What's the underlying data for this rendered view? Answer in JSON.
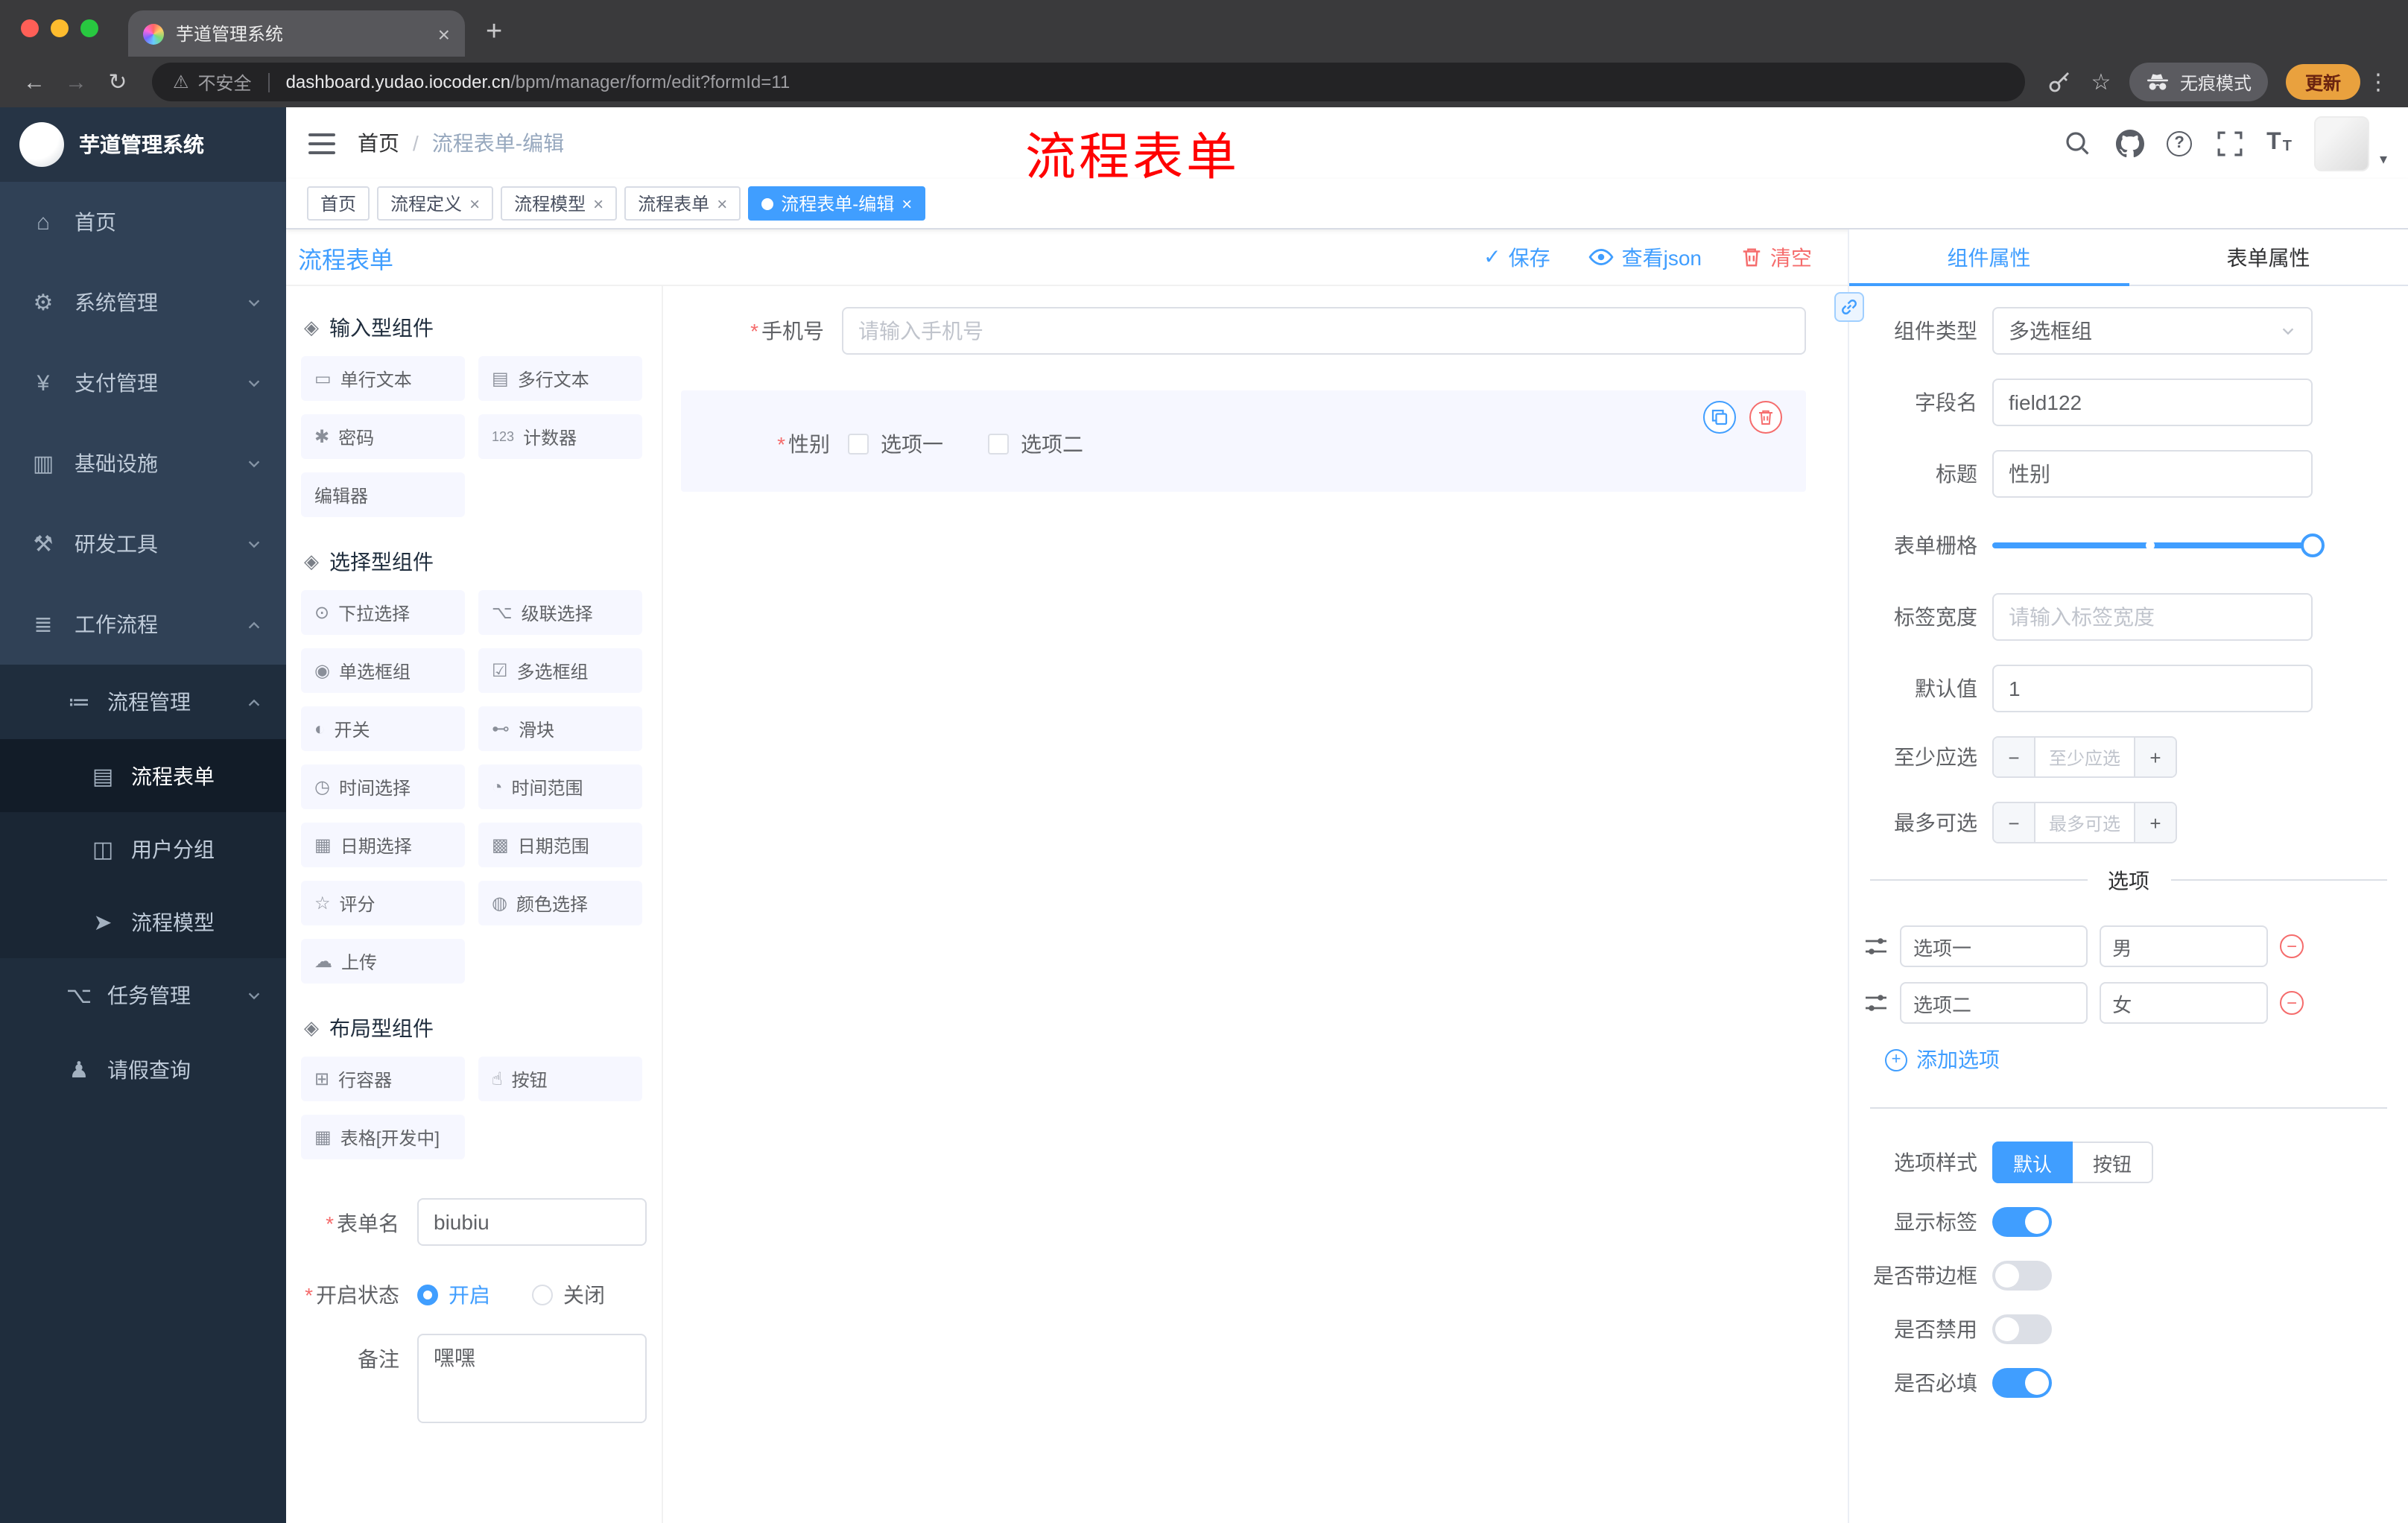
{
  "colors": {
    "accent": "#409eff",
    "danger": "#f56c6c",
    "sidebar_bg": "#304156",
    "sidebar_submenu_bg": "#1f2d3d",
    "active_tag_bg": "#409eff",
    "update_button_bg": "#e9a13e",
    "traffic_red": "#ff5f57",
    "traffic_yellow": "#febc2e",
    "traffic_green": "#28c840"
  },
  "glyphs": {
    "close": "×",
    "plus": "+",
    "minus": "−",
    "back": "←",
    "forward": "→",
    "reload": "↻",
    "warning": "⚠",
    "star": "☆",
    "kebab": "⋮",
    "slash": "/",
    "check": "✓",
    "required": "*",
    "caret_down": "▾",
    "help": "?",
    "font_size_big": "T",
    "font_size_small": "T"
  },
  "browser": {
    "tab_title": "芋道管理系统",
    "security_label": "不安全",
    "url_host": "dashboard.yudao.iocoder.cn",
    "url_path": "/bpm/manager/form/edit?formId=11",
    "incognito_label": "无痕模式",
    "update_label": "更新"
  },
  "sidebar": {
    "logo_title": "芋道管理系统",
    "items": [
      {
        "label": "首页",
        "glyph": "⌂"
      },
      {
        "label": "系统管理",
        "glyph": "⚙"
      },
      {
        "label": "支付管理",
        "glyph": "¥"
      },
      {
        "label": "基础设施",
        "glyph": "▥"
      },
      {
        "label": "研发工具",
        "glyph": "⚒"
      },
      {
        "label": "工作流程",
        "glyph": "≣"
      }
    ],
    "workflow_submenu": {
      "process_mgmt": {
        "label": "流程管理",
        "glyph": "≔"
      },
      "process_children": [
        {
          "label": "流程表单",
          "glyph": "▤"
        },
        {
          "label": "用户分组",
          "glyph": "◫"
        },
        {
          "label": "流程模型",
          "glyph": "➤"
        }
      ],
      "task_mgmt": {
        "label": "任务管理",
        "glyph": "⌥"
      },
      "leave_query": {
        "label": "请假查询",
        "glyph": "♟"
      }
    }
  },
  "header": {
    "breadcrumb": {
      "home": "首页",
      "current": "流程表单-编辑"
    },
    "annotation": "流程表单"
  },
  "tags": [
    {
      "label": "首页"
    },
    {
      "label": "流程定义"
    },
    {
      "label": "流程模型"
    },
    {
      "label": "流程表单"
    },
    {
      "label": "流程表单-编辑"
    }
  ],
  "designer": {
    "title": "流程表单",
    "save": "保存",
    "view_json": "查看json",
    "clear": "清空"
  },
  "palette": {
    "sections": [
      {
        "title": "输入型组件",
        "items": [
          {
            "label": "单行文本",
            "glyph": "▭"
          },
          {
            "label": "多行文本",
            "glyph": "▤"
          },
          {
            "label": "密码",
            "glyph": "✱"
          },
          {
            "label": "计数器",
            "glyph": "123"
          },
          {
            "label": "编辑器",
            "glyph": ""
          }
        ]
      },
      {
        "title": "选择型组件",
        "items": [
          {
            "label": "下拉选择",
            "glyph": "⊙"
          },
          {
            "label": "级联选择",
            "glyph": "⌥"
          },
          {
            "label": "单选框组",
            "glyph": "◉"
          },
          {
            "label": "多选框组",
            "glyph": "☑"
          },
          {
            "label": "开关",
            "glyph": "◐"
          },
          {
            "label": "滑块",
            "glyph": "⊷"
          },
          {
            "label": "时间选择",
            "glyph": "◷"
          },
          {
            "label": "时间范围",
            "glyph": "◔"
          },
          {
            "label": "日期选择",
            "glyph": "▦"
          },
          {
            "label": "日期范围",
            "glyph": "▩"
          },
          {
            "label": "评分",
            "glyph": "☆"
          },
          {
            "label": "颜色选择",
            "glyph": "◍"
          },
          {
            "label": "上传",
            "glyph": "☁"
          }
        ]
      },
      {
        "title": "布局型组件",
        "items": [
          {
            "label": "行容器",
            "glyph": "⊞"
          },
          {
            "label": "按钮",
            "glyph": "☝"
          },
          {
            "label": "表格[开发中]",
            "glyph": "▦"
          }
        ]
      }
    ],
    "form": {
      "name_label": "表单名",
      "name_value": "biubiu",
      "status_label": "开启状态",
      "status_on": "开启",
      "status_off": "关闭",
      "remark_label": "备注",
      "remark_value": "嘿嘿"
    }
  },
  "canvas": {
    "phone": {
      "label": "手机号",
      "placeholder": "请输入手机号"
    },
    "gender": {
      "label": "性别",
      "option1": "选项一",
      "option2": "选项二"
    }
  },
  "props": {
    "tab_component": "组件属性",
    "tab_form": "表单属性",
    "component_type_label": "组件类型",
    "component_type_value": "多选框组",
    "field_name_label": "字段名",
    "field_name_value": "field122",
    "title_label": "标题",
    "title_value": "性别",
    "grid_label": "表单栅格",
    "label_width_label": "标签宽度",
    "label_width_placeholder": "请输入标签宽度",
    "default_label": "默认值",
    "default_value": "1",
    "min_label": "至少应选",
    "min_placeholder": "至少应选",
    "max_label": "最多可选",
    "max_placeholder": "最多可选",
    "options_title": "选项",
    "options": [
      {
        "name": "选项一",
        "value": "男"
      },
      {
        "name": "选项二",
        "value": "女"
      }
    ],
    "add_option": "添加选项",
    "option_style_label": "选项样式",
    "style_default": "默认",
    "style_button": "按钮",
    "show_label": "显示标签",
    "border_label": "是否带边框",
    "disabled_label": "是否禁用",
    "required_label": "是否必填"
  }
}
